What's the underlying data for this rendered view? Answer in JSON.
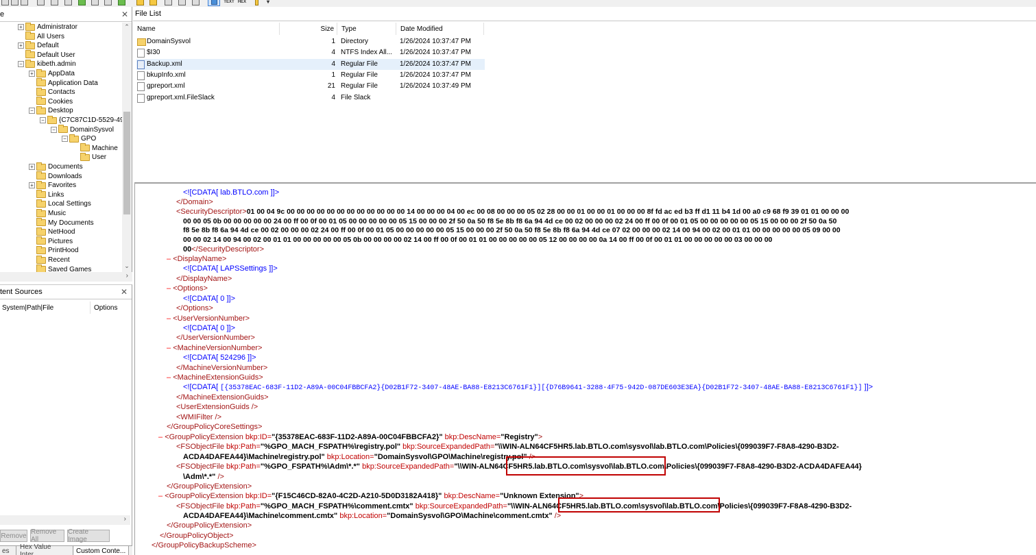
{
  "toolbar": {
    "text_label": "TEXT",
    "hex_label": "HEX"
  },
  "tree_pane": {
    "title": "e",
    "items": [
      {
        "label": "Administrator",
        "toggle": "+"
      },
      {
        "label": "All Users",
        "toggle": ""
      },
      {
        "label": "Default",
        "toggle": "+"
      },
      {
        "label": "Default User",
        "toggle": ""
      },
      {
        "label": "kibeth.admin",
        "toggle": "-"
      },
      {
        "label": "AppData",
        "toggle": "+"
      },
      {
        "label": "Application Data",
        "toggle": ""
      },
      {
        "label": "Contacts",
        "toggle": ""
      },
      {
        "label": "Cookies",
        "toggle": ""
      },
      {
        "label": "Desktop",
        "toggle": "-"
      },
      {
        "label": "{C7C87C1D-5529-495",
        "toggle": "-"
      },
      {
        "label": "DomainSysvol",
        "toggle": "-"
      },
      {
        "label": "GPO",
        "toggle": "-"
      },
      {
        "label": "Machine",
        "toggle": ""
      },
      {
        "label": "User",
        "toggle": ""
      },
      {
        "label": "Documents",
        "toggle": "+"
      },
      {
        "label": "Downloads",
        "toggle": ""
      },
      {
        "label": "Favorites",
        "toggle": "+"
      },
      {
        "label": "Links",
        "toggle": ""
      },
      {
        "label": "Local Settings",
        "toggle": ""
      },
      {
        "label": "Music",
        "toggle": ""
      },
      {
        "label": "My Documents",
        "toggle": ""
      },
      {
        "label": "NetHood",
        "toggle": ""
      },
      {
        "label": "Pictures",
        "toggle": ""
      },
      {
        "label": "PrintHood",
        "toggle": ""
      },
      {
        "label": "Recent",
        "toggle": ""
      },
      {
        "label": "Saved Games",
        "toggle": ""
      }
    ]
  },
  "content_sources": {
    "title": "tent Sources",
    "col_path": "System|Path|File",
    "col_options": "Options",
    "btn_remove": "Remove",
    "btn_remove_all": "Remove All",
    "btn_create_image": "Create Image"
  },
  "bottom_tabs": [
    "es",
    "Hex Value Inter...",
    "Custom Conte..."
  ],
  "file_list": {
    "title": "File List",
    "columns": {
      "name": "Name",
      "size": "Size",
      "type": "Type",
      "date": "Date Modified"
    },
    "rows": [
      {
        "name": "DomainSysvol",
        "size": "1",
        "type": "Directory",
        "date": "1/26/2024 10:37:47 PM",
        "icon": "folder"
      },
      {
        "name": "$I30",
        "size": "4",
        "type": "NTFS Index All...",
        "date": "1/26/2024 10:37:47 PM",
        "icon": "file"
      },
      {
        "name": "Backup.xml",
        "size": "4",
        "type": "Regular File",
        "date": "1/26/2024 10:37:47 PM",
        "icon": "xml"
      },
      {
        "name": "bkupInfo.xml",
        "size": "1",
        "type": "Regular File",
        "date": "1/26/2024 10:37:47 PM",
        "icon": "file"
      },
      {
        "name": "gpreport.xml",
        "size": "21",
        "type": "Regular File",
        "date": "1/26/2024 10:37:49 PM",
        "icon": "file"
      },
      {
        "name": "gpreport.xml.FileSlack",
        "size": "4",
        "type": "File Slack",
        "date": "",
        "icon": "file"
      }
    ]
  },
  "xml": {
    "domain_cdata": "<![CDATA[ lab.BTLO.com  ]]>",
    "domain_close": "</Domain>",
    "secdesc_open": "<SecurityDescriptor>",
    "secdesc_1": "01 00 04 9c 00 00 00 00 00 00 00 00 00 00 00 00 14 00 00 00 04 00 ec 00 08 00 00 00 05 02 28 00 00 01 00 00 01 00 00 00 8f fd ac ed b3 ff d1 11 b4 1d 00 a0 c9 68 f9 39 01 01 00 00 00",
    "secdesc_2": "00 00 05 0b 00 00 00 00 00 24 00 ff 00 0f 00 01 05 00 00 00 00 00 05 15 00 00 00 2f 50 0a 50 f8 5e 8b f8 6a 94 4d ce 00 02 00 00 00 02 24 00 ff 00 0f 00 01 05 00 00 00 00 00 05 15 00 00 00 2f 50 0a 50",
    "secdesc_3": "f8 5e 8b f8 6a 94 4d ce 00 02 00 00 00 02 24 00 ff 00 0f 00 01 05 00 00 00 00 00 05 15 00 00 00 2f 50 0a 50 f8 5e 8b f8 6a 94 4d ce 07 02 00 00 00 02 14 00 94 00 02 00 01 01 00 00 00 00 00 05 09 00 00",
    "secdesc_4": "00 00 02 14 00 94 00 02 00 01 01 00 00 00 00 00 05 0b 00 00 00 00 02 14 00 ff 00 0f 00 01 01 00 00 00 00 00 05 12 00 00 00 00 0a 14 00 ff 00 0f 00 01 01 00 00 00 00 00 03 00 00 00",
    "secdesc_5": "00",
    "secdesc_close": "</SecurityDescriptor>",
    "displayname_open": "<DisplayName>",
    "displayname_cdata": "<![CDATA[ LAPSSettings  ]]>",
    "displayname_close": "</DisplayName>",
    "options_open": "<Options>",
    "options_cdata": "<![CDATA[ 0  ]]>",
    "options_close": "</Options>",
    "uvn_open": "<UserVersionNumber>",
    "uvn_cdata": "<![CDATA[ 0  ]]>",
    "uvn_close": "</UserVersionNumber>",
    "mvn_open": "<MachineVersionNumber>",
    "mvn_cdata": "<![CDATA[ 524296  ]]>",
    "mvn_close": "</MachineVersionNumber>",
    "meg_open": "<MachineExtensionGuids>",
    "meg_cdata_prefix": "<![CDATA[ ",
    "meg_cdata_value": "[{35378EAC-683F-11D2-A89A-00C04FBBCFA2}{D02B1F72-3407-48AE-BA88-E8213C6761F1}][{D76B9641-3288-4F75-942D-087DE603E3EA}{D02B1F72-3407-48AE-BA88-E8213C6761F1}]",
    "meg_cdata_suffix": "  ]]>",
    "meg_close": "</MachineExtensionGuids>",
    "ueg": "<UserExtensionGuids />",
    "wmi": "<WMIFilter />",
    "core_close": "</GroupPolicyCoreSettings>",
    "gpe1_tag": "<GroupPolicyExtension",
    "gpe1_id_attr": " bkp:ID=",
    "gpe1_id_val": "\"{35378EAC-683F-11D2-A89A-00C04FBBCFA2}\"",
    "gpe1_desc_attr": " bkp:DescName=",
    "gpe1_desc_val": "\"Registry\"",
    "gpe1_end": ">",
    "fs1_tag": "<FSObjectFile",
    "fs1_path_attr": " bkp:Path=",
    "fs1_path_val": "\"%GPO_MACH_FSPATH%\\registry.pol\"",
    "fs1_src_attr": " bkp:SourceExpandedPath=",
    "fs1_src_val": "\"\\\\WIN-ALN64CF5HR5.lab.BTLO.com\\sysvol\\lab.BTLO.com\\Policies\\{099039F7-F8A8-4290-B3D2-",
    "fs1_src_val2": "ACDA4DAFEA44}\\Machine\\registry.pol\"",
    "fs1_loc_attr": " bkp:Location=",
    "fs1_loc_val": "\"DomainSysvol\\GPO\\Machine\\registry.pol\"",
    "fs1_end": " />",
    "fs2_tag": "<FSObjectFile",
    "fs2_path_attr": " bkp:Path=",
    "fs2_path_val": "\"%GPO_FSPATH%\\Adm\\*.*\"",
    "fs2_src_attr": " bkp:SourceExpandedPath=",
    "fs2_src_val": "\"\\\\WIN-ALN64CF5HR5.lab.BTLO.com\\sysvol\\lab.BTLO.com\\Policies\\{099039F7-F8A8-4290-B3D2-ACDA4DAFEA44}",
    "fs2_src_val2": "\\Adm\\*.*\"",
    "fs2_end": " />",
    "gpe1_close": "</GroupPolicyExtension>",
    "gpe2_tag": "<GroupPolicyExtension",
    "gpe2_id_attr": " bkp:ID=",
    "gpe2_id_val": "\"{F15C46CD-82A0-4C2D-A210-5D0D3182A418}\"",
    "gpe2_desc_attr": " bkp:DescName=",
    "gpe2_desc_val": "\"Unknown Extension\"",
    "gpe2_end": ">",
    "fs3_tag": "<FSObjectFile",
    "fs3_path_attr": " bkp:Path=",
    "fs3_path_val": "\"%GPO_MACH_FSPATH%\\comment.cmtx\"",
    "fs3_src_attr": " bkp:SourceExpandedPath=",
    "fs3_src_val": "\"\\\\WIN-ALN64CF5HR5.lab.BTLO.com\\sysvol\\lab.BTLO.com\\Policies\\{099039F7-F8A8-4290-B3D2-",
    "fs3_src_val2": "ACDA4DAFEA44}\\Machine\\comment.cmtx\"",
    "fs3_loc_attr": " bkp:Location=",
    "fs3_loc_val": "\"DomainSysvol\\GPO\\Machine\\comment.cmtx\"",
    "fs3_end": " />",
    "gpe2_close": "</GroupPolicyExtension>",
    "gpo_close": "</GroupPolicyObject>",
    "scheme_close": "</GroupPolicyBackupScheme>",
    "minus": "–"
  },
  "colors": {
    "highlight_box": "#c00000",
    "tag": "#a31515",
    "attr_value": "#0000ff"
  }
}
